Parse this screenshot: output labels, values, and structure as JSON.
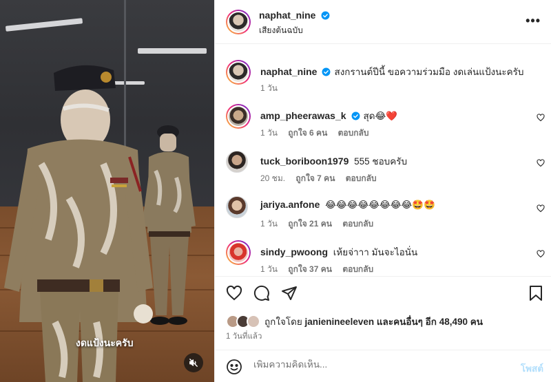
{
  "video": {
    "caption": "งดแป้งนะครับ",
    "mute_icon": "speaker-muted-icon"
  },
  "header": {
    "username": "naphat_nine",
    "audio": "เสียงต้นฉบับ",
    "more_icon": "more-options-icon",
    "more_label": "•••"
  },
  "post": {
    "username": "naphat_nine",
    "caption": "สงกรานต์ปีนี้ ขอความร่วมมือ งดเล่นแป้งนะครับ",
    "time": "1 วัน"
  },
  "comments": [
    {
      "username": "amp_pheerawas_k",
      "verified": true,
      "text": "สุด😂❤️",
      "time": "1 วัน",
      "likes": "ถูกใจ 6 คน",
      "reply": "ตอบกลับ"
    },
    {
      "username": "tuck_boriboon1979",
      "verified": false,
      "text": "555 ชอบครับ",
      "time": "20 ชม.",
      "likes": "ถูกใจ 7 คน",
      "reply": "ตอบกลับ"
    },
    {
      "username": "jariya.anfone",
      "verified": false,
      "text": "😂😂😂😂😂😂😂😂🤩🤩",
      "time": "1 วัน",
      "likes": "ถูกใจ 21 คน",
      "reply": "ตอบกลับ"
    },
    {
      "username": "sindy_pwoong",
      "verified": false,
      "text": "เห้ยจ่าาา มันจะไอนั่น",
      "time": "1 วัน",
      "likes": "ถูกใจ 37 คน",
      "reply": "ตอบกลับ"
    }
  ],
  "actions": {
    "like_icon": "heart-icon",
    "comment_icon": "comment-icon",
    "share_icon": "send-icon",
    "save_icon": "bookmark-icon"
  },
  "likes": {
    "prefix": "ถูกใจโดย",
    "user": "janienineeleven",
    "suffix": "และคนอื่นๆ อีก 48,490 คน"
  },
  "posted_time": "1 วันที่แล้ว",
  "composer": {
    "placeholder": "เพิ่มความคิดเห็น...",
    "post_label": "โพสต์",
    "emoji_icon": "emoji-icon"
  },
  "colors": {
    "verified": "#0095f6",
    "text": "#262626",
    "muted": "#737373",
    "post_button_disabled": "#b2dffc"
  }
}
